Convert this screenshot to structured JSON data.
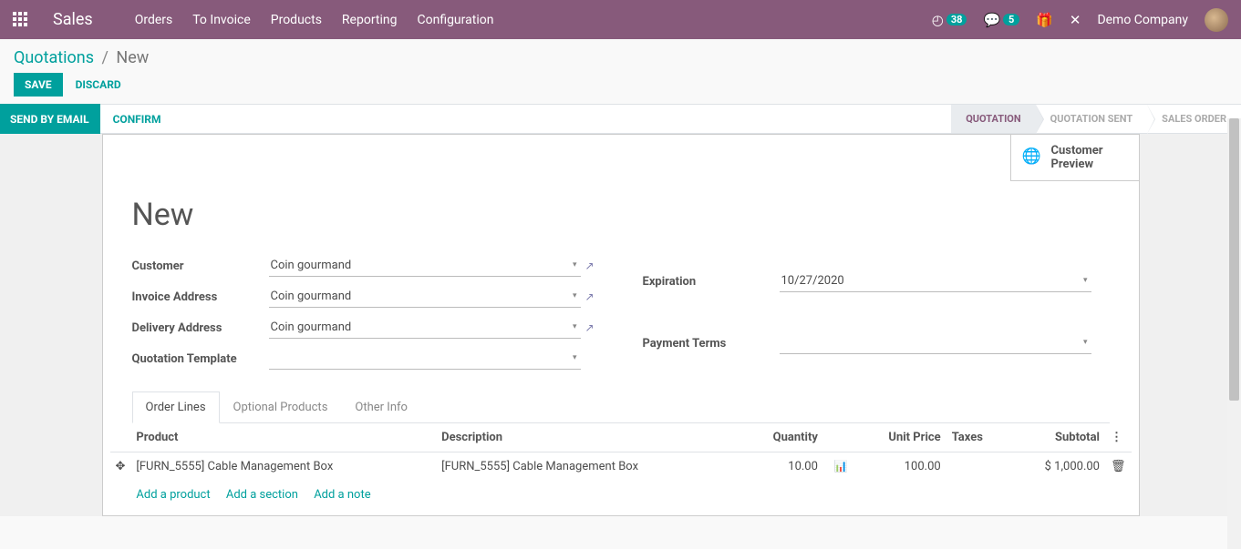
{
  "topbar": {
    "app_name": "Sales",
    "menu": [
      "Orders",
      "To Invoice",
      "Products",
      "Reporting",
      "Configuration"
    ],
    "clock_badge": "38",
    "chat_badge": "5",
    "company": "Demo Company"
  },
  "breadcrumb": {
    "root": "Quotations",
    "current": "New"
  },
  "edit": {
    "save": "Save",
    "discard": "Discard"
  },
  "statusbar": {
    "send": "Send by Email",
    "confirm": "Confirm",
    "steps": [
      {
        "label": "Quotation",
        "active": true
      },
      {
        "label": "Quotation Sent",
        "active": false
      },
      {
        "label": "Sales Order",
        "active": false
      }
    ]
  },
  "button_box": {
    "line1": "Customer",
    "line2": "Preview"
  },
  "title": "New",
  "form": {
    "left": {
      "customer_lbl": "Customer",
      "customer": "Coin gourmand",
      "invoice_lbl": "Invoice Address",
      "invoice": "Coin gourmand",
      "delivery_lbl": "Delivery Address",
      "delivery": "Coin gourmand",
      "template_lbl": "Quotation Template",
      "template": ""
    },
    "right": {
      "exp_lbl": "Expiration",
      "exp": "10/27/2020",
      "terms_lbl": "Payment Terms",
      "terms": ""
    }
  },
  "tabs": [
    "Order Lines",
    "Optional Products",
    "Other Info"
  ],
  "lines": {
    "headers": {
      "product": "Product",
      "description": "Description",
      "qty": "Quantity",
      "price": "Unit Price",
      "taxes": "Taxes",
      "subtotal": "Subtotal"
    },
    "rows": [
      {
        "product": "[FURN_5555] Cable Management Box",
        "description": "[FURN_5555] Cable Management Box",
        "qty": "10.00",
        "price": "100.00",
        "taxes": "",
        "subtotal": "$ 1,000.00"
      }
    ],
    "add_product": "Add a product",
    "add_section": "Add a section",
    "add_note": "Add a note"
  }
}
